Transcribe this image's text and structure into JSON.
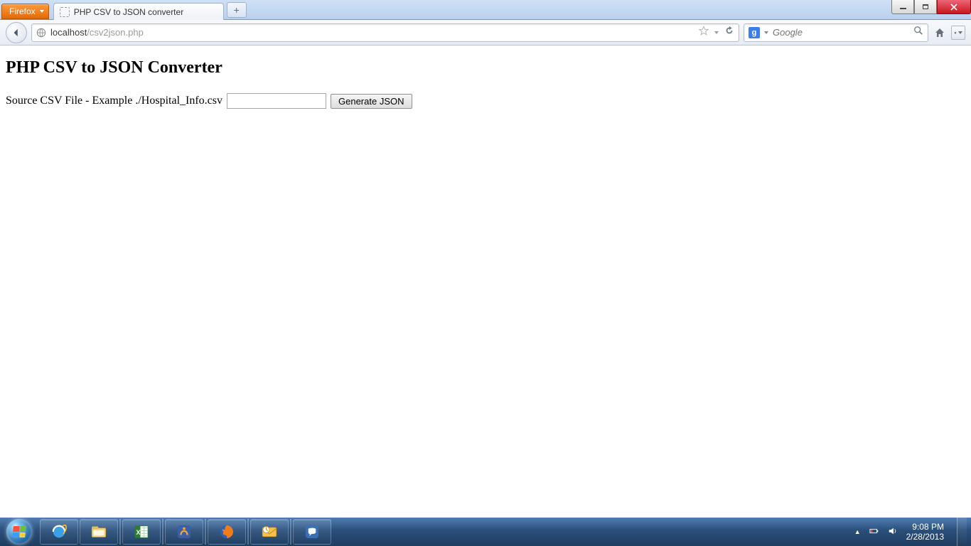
{
  "browser": {
    "menu_label": "Firefox",
    "tab_title": "PHP CSV to JSON converter",
    "newtab_label": "+",
    "url_host": "localhost",
    "url_path": "/csv2json.php",
    "search_placeholder": "Google",
    "search_engine_letter": "g"
  },
  "page": {
    "heading": "PHP CSV to JSON Converter",
    "form_label": "Source CSV File - Example ./Hospital_Info.csv",
    "input_value": "",
    "submit_label": "Generate JSON"
  },
  "system": {
    "time": "9:08 PM",
    "date": "2/28/2013"
  }
}
